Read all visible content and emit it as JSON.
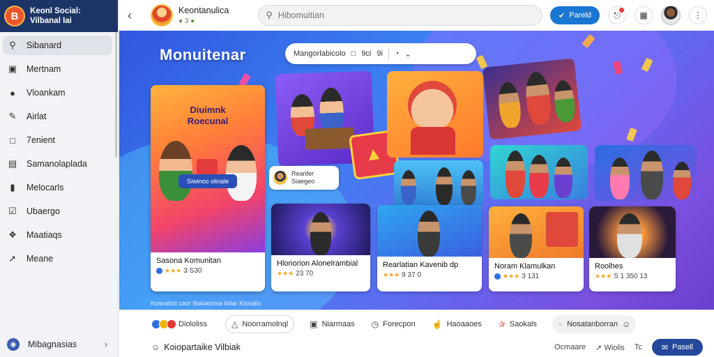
{
  "brand": {
    "title_line1": "Keonl Social:",
    "title_line2": "Vilbanal Iai",
    "logo_glyph": "B"
  },
  "sidebar": {
    "items": [
      {
        "label": "Sibanard",
        "icon": "search-icon",
        "active": true
      },
      {
        "label": "Mertnam",
        "icon": "image-icon"
      },
      {
        "label": "Vloankam",
        "icon": "chat-icon"
      },
      {
        "label": "Airlat",
        "icon": "pen-icon"
      },
      {
        "label": "7enient",
        "icon": "lock-icon"
      },
      {
        "label": "Samanolaplada",
        "icon": "edit-icon"
      },
      {
        "label": "Melocarls",
        "icon": "bookmark-icon"
      },
      {
        "label": "Ubaergo",
        "icon": "check-icon"
      },
      {
        "label": "Maatiaqs",
        "icon": "share-icon"
      },
      {
        "label": "Meane",
        "icon": "arrow-icon"
      }
    ],
    "footer_label": "Mibagnasias"
  },
  "topbar": {
    "channel_name": "Keontanulica",
    "channel_meta": "● 3 ●",
    "search_placeholder": "Hibomuitian",
    "primary_button": "Pareld"
  },
  "banner": {
    "title": "Monuitenar",
    "filter": {
      "text": "Mangorlabicolo",
      "count_a": "9ci",
      "count_b": "9i"
    },
    "featured": {
      "heading_line1": "Diuimnk",
      "heading_line2": "Roecunal",
      "sign": "Siwinoo olinale",
      "title": "Sasona Komunitan",
      "stats": "3 S30"
    },
    "callout": {
      "line1": "Reanfer",
      "line2": "Siaegeo"
    },
    "cards": [
      {
        "title": "Hlonorion Alonelrambial",
        "stats": "23 70"
      },
      {
        "title": "Rearlatian Kavenib dp",
        "stats": "9 37 0"
      },
      {
        "title": "Noram Klamulkan",
        "stats": "3 131"
      },
      {
        "title": "Roolhes",
        "stats": "S 1 350 13"
      }
    ],
    "caption": "Kosnabot caor Bokiatrosa lbliar Kiosalis"
  },
  "actionbar": {
    "reactions_label": "Diololiss",
    "comment": "Noorramolnql",
    "item3": "Niarmaas",
    "item4": "Forecpon",
    "item5": "Haoaaoes",
    "item6": "Saokals",
    "item7": "Nosatanborran"
  },
  "composer": {
    "placeholder": "Koiopartaike Vilbiak",
    "item_a": "Ocmaare",
    "item_b": "Wiolis",
    "item_c": "Tc",
    "post_button": "Pasell"
  },
  "colors": {
    "accent": "#1976d2",
    "brand": "#1d3566",
    "banner_start": "#3156e0",
    "banner_end": "#6a3fd0"
  }
}
